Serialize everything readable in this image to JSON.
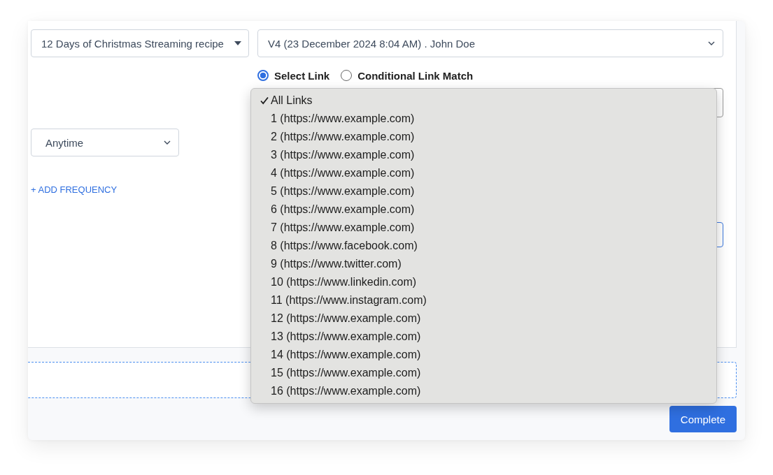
{
  "recipe_select": {
    "value": "12 Days of Christmas Streaming recipe"
  },
  "version_select": {
    "value": "V4 (23 December 2024 8:04 AM) . John Doe"
  },
  "link_modes": [
    {
      "label": "Select Link",
      "selected": true
    },
    {
      "label": "Conditional Link Match",
      "selected": false
    }
  ],
  "time_select": {
    "value": "Anytime"
  },
  "add_frequency": "+ ADD FREQUENCY",
  "link_menu": [
    {
      "label": "All Links",
      "selected": true
    },
    {
      "label": "1 (https://www.example.com)",
      "selected": false
    },
    {
      "label": "2 (https://www.example.com)",
      "selected": false
    },
    {
      "label": "3 (https://www.example.com)",
      "selected": false
    },
    {
      "label": "4 (https://www.example.com)",
      "selected": false
    },
    {
      "label": "5 (https://www.example.com)",
      "selected": false
    },
    {
      "label": "6 (https://www.example.com)",
      "selected": false
    },
    {
      "label": "7 (https://www.example.com)",
      "selected": false
    },
    {
      "label": "8 (https://www.facebook.com)",
      "selected": false
    },
    {
      "label": "9 (https://www.twitter.com)",
      "selected": false
    },
    {
      "label": "10 (https://www.linkedin.com)",
      "selected": false
    },
    {
      "label": "11 (https://www.instagram.com)",
      "selected": false
    },
    {
      "label": "12 (https://www.example.com)",
      "selected": false
    },
    {
      "label": "13 (https://www.example.com)",
      "selected": false
    },
    {
      "label": "14 (https://www.example.com)",
      "selected": false
    },
    {
      "label": "15 (https://www.example.com)",
      "selected": false
    },
    {
      "label": "16 (https://www.example.com)",
      "selected": false
    }
  ],
  "complete_button": "Complete"
}
